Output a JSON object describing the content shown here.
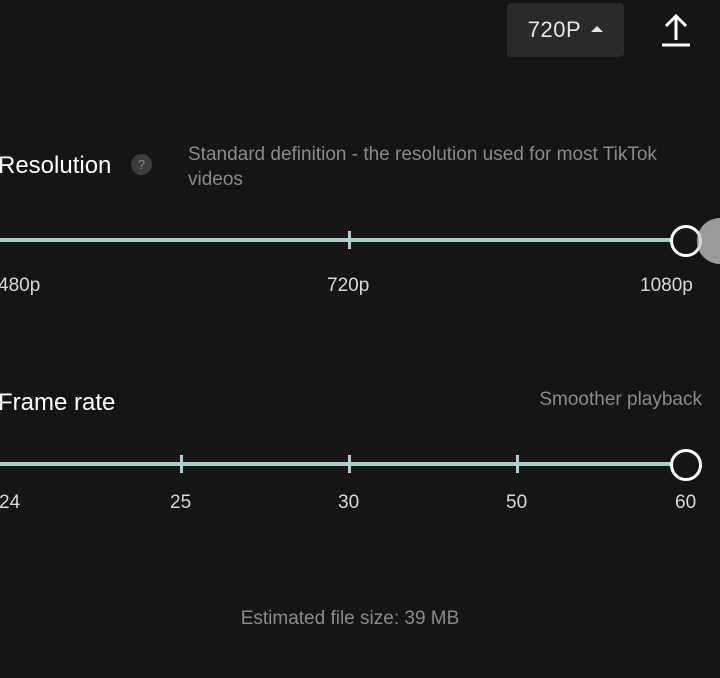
{
  "header": {
    "resolution_dropdown": "720P",
    "export_icon": "upload-icon"
  },
  "resolution": {
    "title": "Resolution",
    "help_icon": "?",
    "description": "Standard definition - the resolution used for most TikTok videos",
    "options": [
      "480p",
      "720p",
      "1080p"
    ],
    "selected": "1080p"
  },
  "frame_rate": {
    "title": "Frame rate",
    "hint": "Smoother playback",
    "options": [
      "24",
      "25",
      "30",
      "50",
      "60"
    ],
    "selected": "60"
  },
  "estimate": {
    "file_size": "Estimated file size: 39 MB"
  },
  "colors": {
    "background": "#151515",
    "track": "#a3d3cf",
    "muted_text": "#8a8a8a"
  }
}
